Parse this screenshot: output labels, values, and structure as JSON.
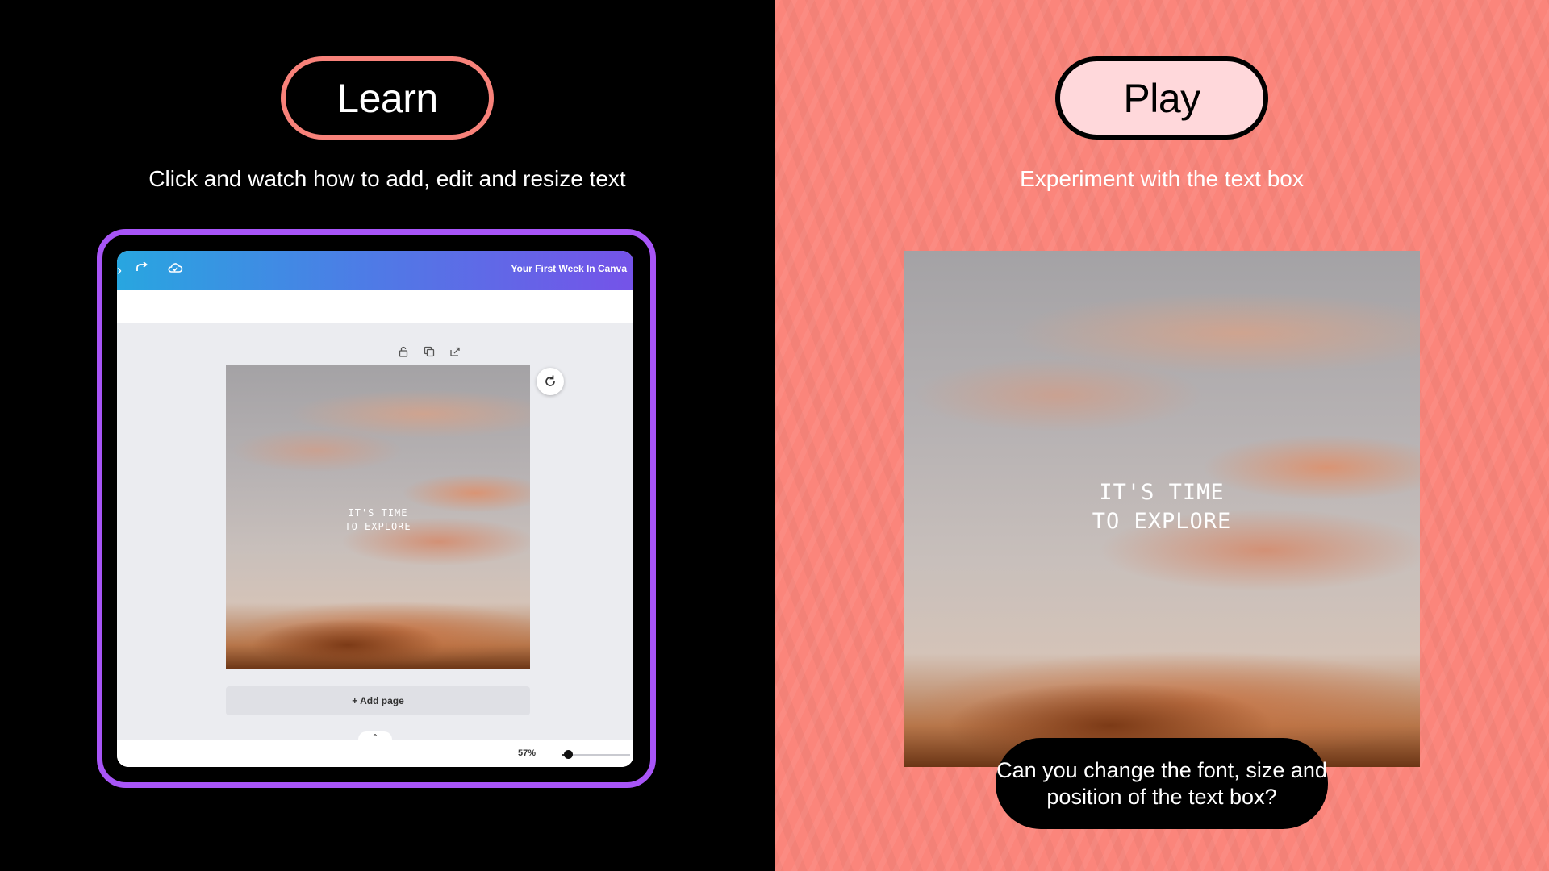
{
  "learn": {
    "pill_label": "Learn",
    "subtitle": "Click and watch how to add, edit and resize text",
    "frame_color": "#a855f7",
    "video": {
      "toolbar_icons": [
        "redo-icon",
        "cloud-save-icon"
      ],
      "document_title": "Your First Week In Canva",
      "element_tools": [
        "lock-icon",
        "duplicate-icon",
        "share-icon"
      ],
      "design_text": "IT'S TIME\nTO EXPLORE",
      "add_page_label": "+ Add page",
      "zoom_label": "57%",
      "zoom_level_percent": 57
    }
  },
  "play": {
    "pill_label": "Play",
    "subtitle": "Experiment with the text box",
    "design_text": "IT'S TIME\nTO EXPLORE",
    "prompt": "Can you change the font, size and position of the text box?"
  },
  "colors": {
    "learn_accent": "#f8827a",
    "play_background": "#fb857b",
    "play_pill_fill": "#ffd8db"
  }
}
